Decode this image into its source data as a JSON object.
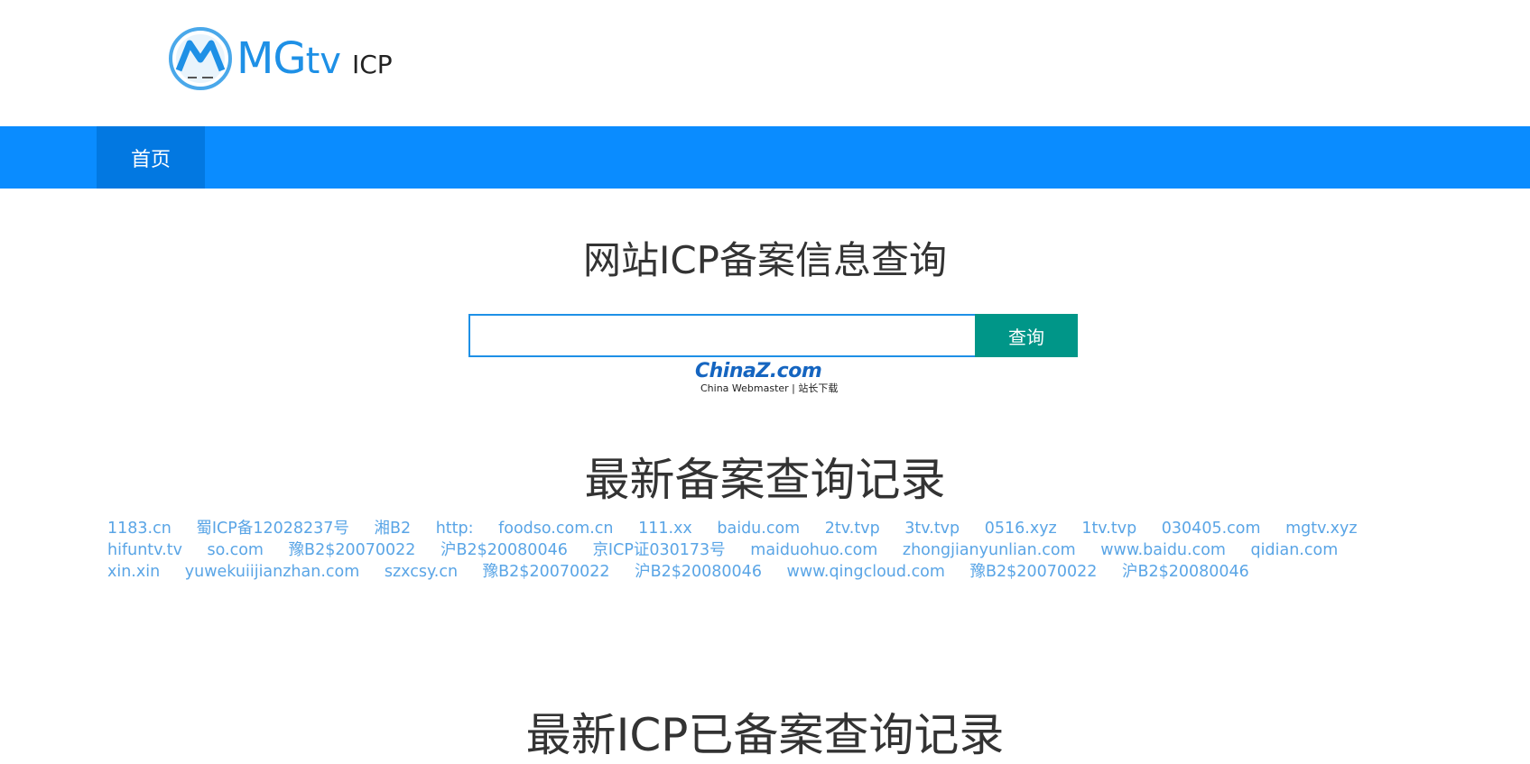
{
  "logo": {
    "brand_mg": "MG",
    "brand_tv": "tv",
    "suffix": "ICP"
  },
  "nav": {
    "home": "首页"
  },
  "main": {
    "title": "网站ICP备案信息查询",
    "search_placeholder": "",
    "search_button": "查询"
  },
  "watermark": {
    "brand": "ChinaZ.com",
    "sub": "China Webmaster | 站长下载"
  },
  "recent": {
    "title": "最新备案查询记录",
    "records": [
      "1183.cn",
      "蜀ICP备12028237号",
      "湘B2",
      "http:",
      "foodso.com.cn",
      "111.xx",
      "baidu.com",
      "2tv.tvp",
      "3tv.tvp",
      "0516.xyz",
      "1tv.tvp",
      "030405.com",
      "mgtv.xyz",
      "hifuntv.tv",
      "so.com",
      "豫B2$20070022",
      "沪B2$20080046",
      "京ICP证030173号",
      "maiduohuo.com",
      "zhongjianyunlian.com",
      "www.baidu.com",
      "qidian.com",
      "xin.xin",
      "yuwekuiijianzhan.com",
      "szxcsy.cn",
      "豫B2$20070022",
      "沪B2$20080046",
      "www.qingcloud.com",
      "豫B2$20070022",
      "沪B2$20080046"
    ]
  },
  "icp_recent": {
    "title": "最新ICP已备案查询记录"
  },
  "colors": {
    "nav_bg": "#0a8cff",
    "nav_active": "#0278e1",
    "search_button": "#009688",
    "link": "#5aa5e6",
    "logo": "#1e90e6"
  }
}
